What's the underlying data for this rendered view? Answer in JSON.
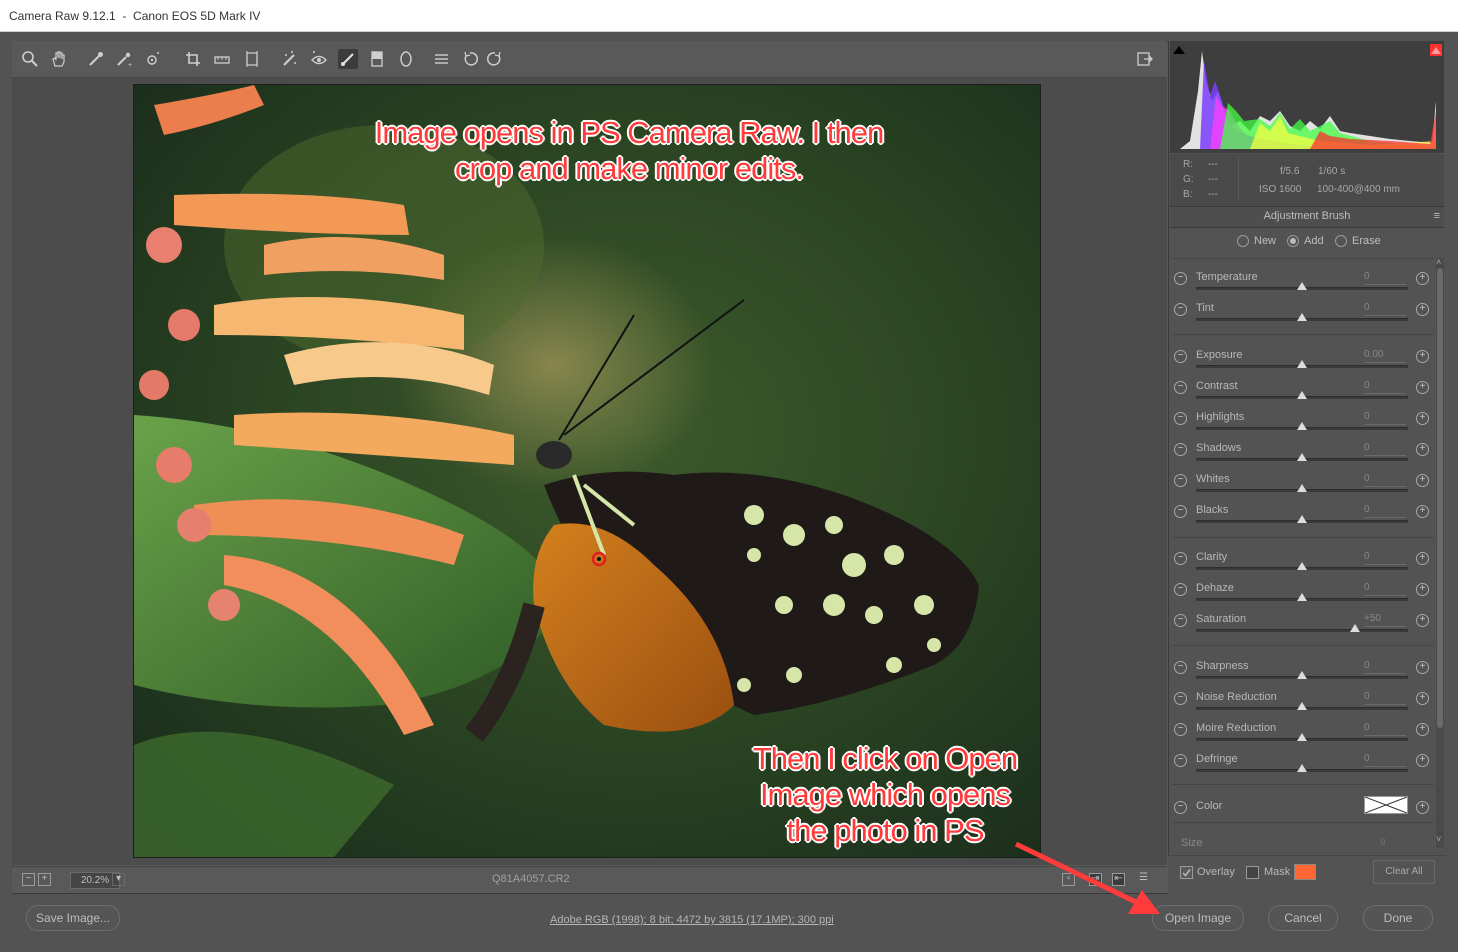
{
  "window": {
    "title": "Camera Raw 9.12.1  -  Canon EOS 5D Mark IV"
  },
  "toolbar": {
    "tools": [
      "zoom-tool-icon",
      "hand-tool-icon",
      "white-balance-tool-icon",
      "color-sampler-tool-icon",
      "targeted-adjustment-tool-icon",
      "crop-tool-icon",
      "straighten-tool-icon",
      "transform-tool-icon",
      "spot-removal-tool-icon",
      "red-eye-removal-tool-icon",
      "adjustment-brush-tool-icon",
      "graduated-filter-tool-icon",
      "radial-filter-tool-icon",
      "preferences-icon",
      "rotate-ccw-icon",
      "rotate-cw-icon"
    ],
    "active_tool": "adjustment-brush-tool-icon"
  },
  "annotations": {
    "top": [
      "Image opens in PS Camera Raw. I then",
      "crop and make minor edits."
    ],
    "bottom": [
      "Then I click on Open",
      "Image which opens",
      "the photo in PS"
    ]
  },
  "status": {
    "zoom": "20.2%",
    "filename": "Q81A4057.CR2"
  },
  "info": {
    "rgb_labels": [
      "R:",
      "G:",
      "B:"
    ],
    "rgb_values": [
      "---",
      "---",
      "---"
    ],
    "aperture": "f/5.6",
    "shutter": "1/60 s",
    "iso": "ISO 1600",
    "lens": "100-400@400 mm"
  },
  "panel": {
    "title": "Adjustment Brush",
    "modes": [
      "New",
      "Add",
      "Erase"
    ],
    "selected_mode": "Add",
    "sliders": [
      {
        "label": "Temperature",
        "value": "0",
        "pos": 0.5
      },
      {
        "label": "Tint",
        "value": "0",
        "pos": 0.5
      },
      {
        "label": "Exposure",
        "value": "0.00",
        "pos": 0.5
      },
      {
        "label": "Contrast",
        "value": "0",
        "pos": 0.5
      },
      {
        "label": "Highlights",
        "value": "0",
        "pos": 0.5
      },
      {
        "label": "Shadows",
        "value": "0",
        "pos": 0.5
      },
      {
        "label": "Whites",
        "value": "0",
        "pos": 0.5
      },
      {
        "label": "Blacks",
        "value": "0",
        "pos": 0.5
      },
      {
        "label": "Clarity",
        "value": "0",
        "pos": 0.5
      },
      {
        "label": "Dehaze",
        "value": "0",
        "pos": 0.5
      },
      {
        "label": "Saturation",
        "value": "+50",
        "pos": 0.75
      },
      {
        "label": "Sharpness",
        "value": "0",
        "pos": 0.5
      },
      {
        "label": "Noise Reduction",
        "value": "0",
        "pos": 0.5
      },
      {
        "label": "Moire Reduction",
        "value": "0",
        "pos": 0.5
      },
      {
        "label": "Defringe",
        "value": "0",
        "pos": 0.5
      }
    ],
    "color_label": "Color",
    "size_label": "Size",
    "size_value": "9",
    "overlay_label": "Overlay",
    "mask_label": "Mask",
    "clear_all": "Clear All",
    "mask_color": "#ff6633"
  },
  "bottom": {
    "save_image": "Save Image...",
    "workflow_link": "Adobe RGB (1998); 8 bit; 4472 by 3815 (17.1MP); 300 ppi",
    "open_image": "Open Image",
    "cancel": "Cancel",
    "done": "Done"
  }
}
